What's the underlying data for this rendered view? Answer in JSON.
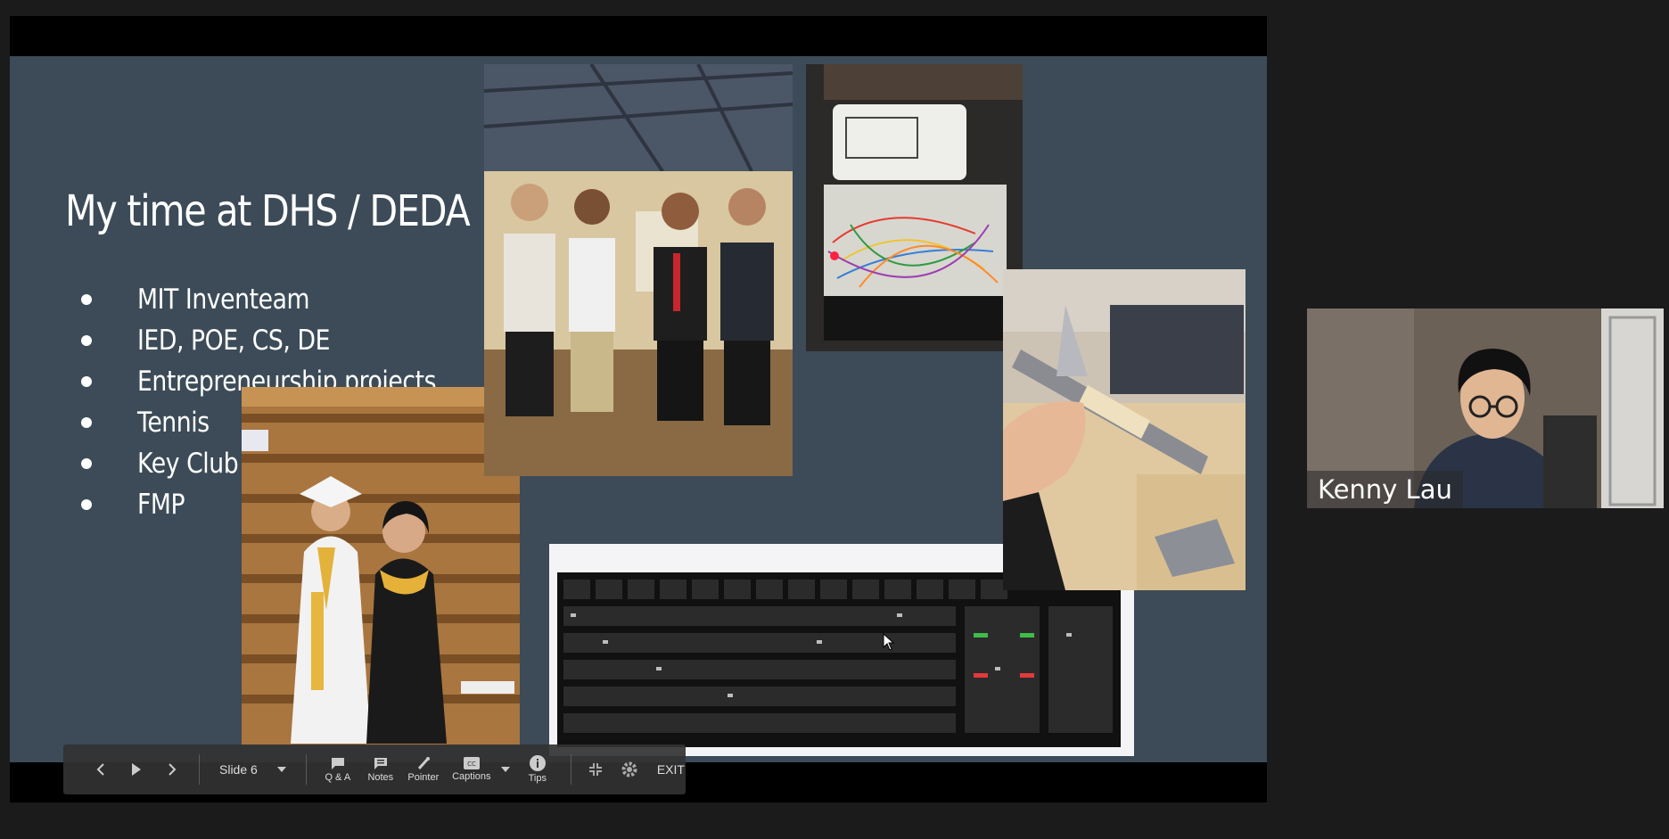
{
  "slide": {
    "title": "My time at DHS / DEDA",
    "bullets": [
      "MIT Inventeam",
      "IED, POE, CS, DE",
      "Entrepreneurship projects",
      "Tennis",
      "Key Club",
      "FMP"
    ]
  },
  "toolbar": {
    "slide_label": "Slide 6",
    "qa_label": "Q & A",
    "notes_label": "Notes",
    "pointer_label": "Pointer",
    "captions_label": "Captions",
    "tips_label": "Tips",
    "exit_label": "EXIT"
  },
  "participant": {
    "name": "Kenny Lau"
  },
  "colors": {
    "slide_background": "#3c4b57",
    "toolbar_background": "#323232"
  }
}
